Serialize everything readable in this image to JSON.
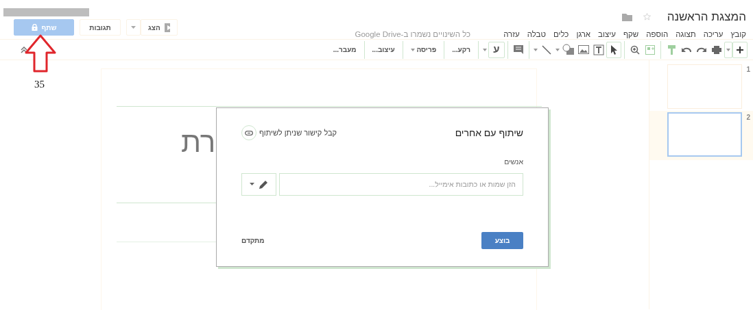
{
  "document": {
    "title": "המצגת הראשנה",
    "starred": false
  },
  "menu": [
    "קובץ",
    "עריכה",
    "תצוגה",
    "הוספה",
    "שקף",
    "עיצוב",
    "ארגן",
    "כלים",
    "טבלה",
    "עזרה"
  ],
  "save_status": "כל השינויים נשמרו ב-Google Drive",
  "header_buttons": {
    "present": "הצג",
    "comments": "תגובות",
    "share": "שתף"
  },
  "toolbar": {
    "select_tool": {
      "selected": true
    },
    "input_tool": "ע",
    "buttons": [
      "רקע...",
      "פריסה",
      "עיצוב...",
      "מעבר..."
    ]
  },
  "annotation": {
    "label": "35"
  },
  "canvas": {
    "title_fragment": "רת"
  },
  "slides": [
    {
      "number": "1",
      "selected": false
    },
    {
      "number": "2",
      "selected": true
    }
  ],
  "dialog": {
    "title": "שיתוף עם אחרים",
    "link_text": "קבל קישור שניתן לשיתוף",
    "people_label": "אנשים",
    "placeholder": "הזן שמות או כתובות אימייל...",
    "done": "בוצע",
    "advanced": "מתקדם"
  }
}
